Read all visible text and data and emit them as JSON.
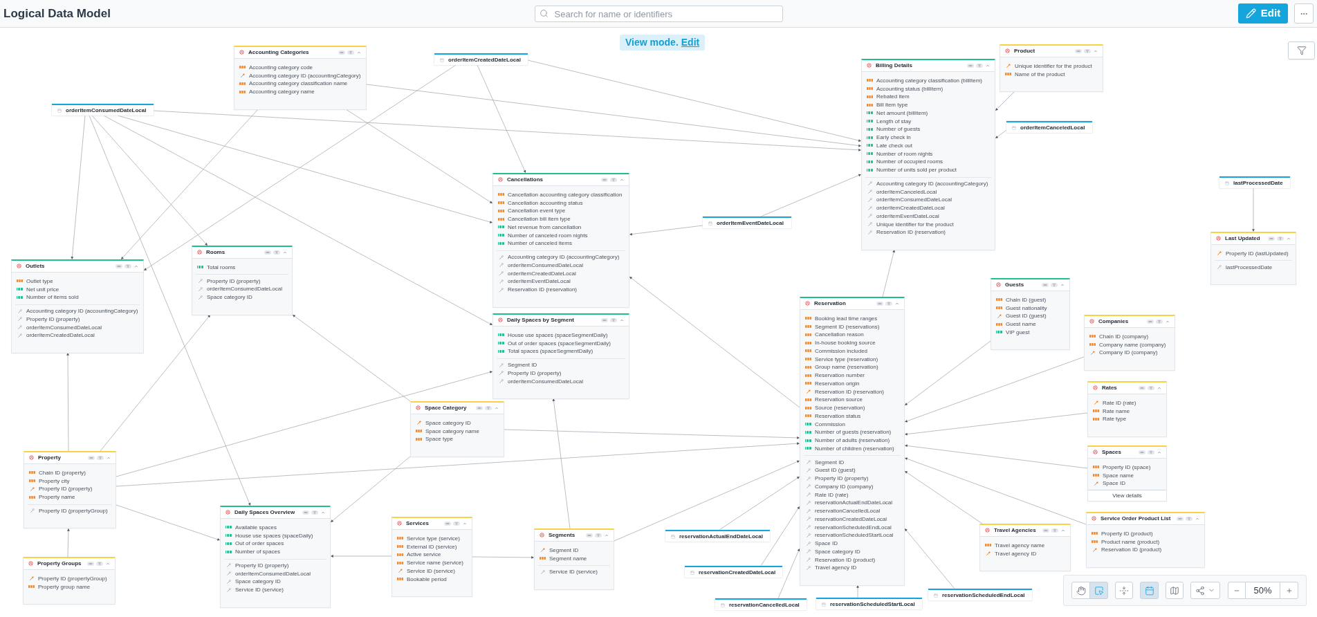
{
  "header": {
    "title": "Logical Data Model",
    "search": {
      "placeholder": "Search for name or identifiers"
    },
    "edit_button": "Edit"
  },
  "banner": {
    "text": "View mode.",
    "link": "Edit"
  },
  "datasets": [
    {
      "title": "Accounting Categories",
      "color": "#f7d344",
      "fields": [
        {
          "label": "Accounting category code",
          "kind": "attribute"
        },
        {
          "label": "Accounting category ID (accountingCategory)",
          "kind": "key"
        },
        {
          "label": "Accounting category classification name",
          "kind": "attribute"
        },
        {
          "label": "Accounting category name",
          "kind": "attribute"
        }
      ]
    },
    {
      "title": "Product",
      "color": "#f7d344",
      "fields": [
        {
          "label": "Unique identifier for the product",
          "kind": "key"
        },
        {
          "label": "Name of the product",
          "kind": "attribute"
        }
      ]
    },
    {
      "title": "Billing Details",
      "color": "#1dbf8e",
      "fields": [
        {
          "label": "Accounting category classification (billItem)",
          "kind": "attribute"
        },
        {
          "label": "Accounting status (billItem)",
          "kind": "attribute"
        },
        {
          "label": "Rebated item",
          "kind": "attribute"
        },
        {
          "label": "Bill item type",
          "kind": "attribute"
        },
        {
          "label": "Net amount (billItem)",
          "kind": "fact"
        },
        {
          "label": "Length of stay",
          "kind": "fact"
        },
        {
          "label": "Number of guests",
          "kind": "fact"
        },
        {
          "label": "Early check in",
          "kind": "fact"
        },
        {
          "label": "Late check out",
          "kind": "fact"
        },
        {
          "label": "Number of room nights",
          "kind": "fact"
        },
        {
          "label": "Number of occupied rooms",
          "kind": "fact"
        },
        {
          "label": "Number of units sold per product",
          "kind": "fact"
        }
      ],
      "references": [
        "Accounting category ID (accountingCategory)",
        "orderItemCanceledLocal",
        "orderItemConsumedDateLocal",
        "orderItemCreatedDateLocal",
        "orderItemEventDateLocal",
        "Unique identifier for the product",
        "Reservation ID (reservation)"
      ]
    },
    {
      "title": "Cancellations",
      "color": "#1dbf8e",
      "fields": [
        {
          "label": "Cancellation accounting category classification",
          "kind": "attribute"
        },
        {
          "label": "Cancellation accounting status",
          "kind": "attribute"
        },
        {
          "label": "Cancellation event type",
          "kind": "attribute"
        },
        {
          "label": "Cancellation bill item type",
          "kind": "attribute"
        },
        {
          "label": "Net revenue from cancellation",
          "kind": "fact"
        },
        {
          "label": "Number of canceled room nights",
          "kind": "fact"
        },
        {
          "label": "Number of canceled items",
          "kind": "fact"
        }
      ],
      "references": [
        "Accounting category ID (accountingCategory)",
        "orderItemConsumedDateLocal",
        "orderItemCreatedDateLocal",
        "orderItemEventDateLocal",
        "Reservation ID (reservation)"
      ]
    },
    {
      "title": "Last Updated",
      "color": "#f7d344",
      "fields": [
        {
          "label": "Property ID (lastUpdated)",
          "kind": "key"
        }
      ],
      "references": [
        "lastProcessedDate"
      ]
    },
    {
      "title": "Outlets",
      "color": "#1dbf8e",
      "fields": [
        {
          "label": "Outlet type",
          "kind": "attribute"
        },
        {
          "label": "Net unit price",
          "kind": "fact"
        },
        {
          "label": "Number of items sold",
          "kind": "fact"
        }
      ],
      "references": [
        "Accounting category ID (accountingCategory)",
        "Property ID (property)",
        "orderItemConsumedDateLocal",
        "orderItemCreatedDateLocal"
      ]
    },
    {
      "title": "Rooms",
      "color": "#1dbf8e",
      "fields": [
        {
          "label": "Total rooms",
          "kind": "fact"
        }
      ],
      "references": [
        "Property ID (property)",
        "orderItemConsumedDateLocal",
        "Space category ID"
      ]
    },
    {
      "title": "Guests",
      "color": "#1dbf8e",
      "fields": [
        {
          "label": "Chain ID (guest)",
          "kind": "attribute"
        },
        {
          "label": "Guest nationality",
          "kind": "attribute"
        },
        {
          "label": "Guest ID (guest)",
          "kind": "key"
        },
        {
          "label": "Guest name",
          "kind": "attribute"
        },
        {
          "label": "VIP guest",
          "kind": "fact"
        }
      ]
    },
    {
      "title": "Reservation",
      "color": "#1dbf8e",
      "fields": [
        {
          "label": "Booking lead time ranges",
          "kind": "attribute"
        },
        {
          "label": "Segment ID (reservations)",
          "kind": "attribute"
        },
        {
          "label": "Cancellation reason",
          "kind": "attribute"
        },
        {
          "label": "In-house booking source",
          "kind": "attribute"
        },
        {
          "label": "Commission included",
          "kind": "attribute"
        },
        {
          "label": "Service type (reservation)",
          "kind": "attribute"
        },
        {
          "label": "Group name (reservation)",
          "kind": "attribute"
        },
        {
          "label": "Reservation number",
          "kind": "attribute"
        },
        {
          "label": "Reservation origin",
          "kind": "attribute"
        },
        {
          "label": "Reservation ID (reservation)",
          "kind": "key"
        },
        {
          "label": "Reservation source",
          "kind": "attribute"
        },
        {
          "label": "Source (reservation)",
          "kind": "attribute"
        },
        {
          "label": "Reservation status",
          "kind": "attribute"
        },
        {
          "label": "Commission",
          "kind": "fact"
        },
        {
          "label": "Number of guests (reservation)",
          "kind": "fact"
        },
        {
          "label": "Number of adults (reservation)",
          "kind": "fact"
        },
        {
          "label": "Number of children (reservation)",
          "kind": "fact"
        }
      ],
      "references": [
        "Segment ID",
        "Guest ID (guest)",
        "Property ID (property)",
        "Company ID (company)",
        "Rate ID (rate)",
        "reservationActualEndDateLocal",
        "reservationCancelledLocal",
        "reservationCreatedDateLocal",
        "reservationScheduledEndLocal",
        "reservationScheduledStartLocal",
        "Space ID",
        "Space category ID",
        "Reservation ID (product)",
        "Travel agency ID"
      ]
    },
    {
      "title": "Daily Spaces by Segment",
      "color": "#1dbf8e",
      "fields": [
        {
          "label": "House use spaces (spaceSegmentDaily)",
          "kind": "fact"
        },
        {
          "label": "Out of order spaces (spaceSegmentDaily)",
          "kind": "fact"
        },
        {
          "label": "Total spaces (spaceSegmentDaily)",
          "kind": "fact"
        }
      ],
      "references": [
        "Segment ID",
        "Property ID (property)",
        "orderItemConsumedDateLocal"
      ]
    },
    {
      "title": "Companies",
      "color": "#f7d344",
      "fields": [
        {
          "label": "Chain ID (company)",
          "kind": "attribute"
        },
        {
          "label": "Company name (company)",
          "kind": "attribute"
        },
        {
          "label": "Company ID (company)",
          "kind": "key"
        }
      ]
    },
    {
      "title": "Rates",
      "color": "#f7d344",
      "fields": [
        {
          "label": "Rate ID (rate)",
          "kind": "key"
        },
        {
          "label": "Rate name",
          "kind": "attribute"
        },
        {
          "label": "Rate type",
          "kind": "attribute"
        }
      ]
    },
    {
      "title": "Space Category",
      "color": "#f7d344",
      "fields": [
        {
          "label": "Space category ID",
          "kind": "key"
        },
        {
          "label": "Space category name",
          "kind": "attribute"
        },
        {
          "label": "Space type",
          "kind": "attribute"
        }
      ]
    },
    {
      "title": "Spaces",
      "color": "#f7d344",
      "fields": [
        {
          "label": "Property ID (space)",
          "kind": "attribute"
        },
        {
          "label": "Space name",
          "kind": "attribute"
        },
        {
          "label": "Space ID",
          "kind": "key"
        }
      ],
      "button": "View details"
    },
    {
      "title": "Property",
      "color": "#f7d344",
      "fields": [
        {
          "label": "Chain ID (property)",
          "kind": "attribute"
        },
        {
          "label": "Property city",
          "kind": "attribute"
        },
        {
          "label": "Property ID (property)",
          "kind": "key"
        },
        {
          "label": "Property name",
          "kind": "attribute"
        }
      ],
      "references": [
        "Property ID (propertyGroup)"
      ]
    },
    {
      "title": "Daily Spaces Overview",
      "color": "#1dbf8e",
      "fields": [
        {
          "label": "Available spaces",
          "kind": "fact"
        },
        {
          "label": "House use spaces (spaceDaily)",
          "kind": "fact"
        },
        {
          "label": "Out of order spaces",
          "kind": "fact"
        },
        {
          "label": "Number of spaces",
          "kind": "fact"
        }
      ],
      "references": [
        "Property ID (property)",
        "orderItemConsumedDateLocal",
        "Space category ID",
        "Service ID (service)"
      ]
    },
    {
      "title": "Services",
      "color": "#f7d344",
      "fields": [
        {
          "label": "Service type (service)",
          "kind": "attribute"
        },
        {
          "label": "External ID (service)",
          "kind": "attribute"
        },
        {
          "label": "Active service",
          "kind": "attribute"
        },
        {
          "label": "Service name (service)",
          "kind": "attribute"
        },
        {
          "label": "Service ID (service)",
          "kind": "key"
        },
        {
          "label": "Bookable period",
          "kind": "attribute"
        }
      ]
    },
    {
      "title": "Segments",
      "color": "#f7d344",
      "fields": [
        {
          "label": "Segment ID",
          "kind": "key"
        },
        {
          "label": "Segment name",
          "kind": "attribute"
        }
      ],
      "references": [
        "Service ID (service)"
      ]
    },
    {
      "title": "Travel Agencies",
      "color": "#f7d344",
      "fields": [
        {
          "label": "Travel agency name",
          "kind": "attribute"
        },
        {
          "label": "Travel agency ID",
          "kind": "key"
        }
      ]
    },
    {
      "title": "Service Order Product List",
      "color": "#f7d344",
      "fields": [
        {
          "label": "Property ID (product)",
          "kind": "attribute"
        },
        {
          "label": "Product name (product)",
          "kind": "attribute"
        },
        {
          "label": "Reservation ID (product)",
          "kind": "key"
        }
      ]
    },
    {
      "title": "Property Groups",
      "color": "#f7d344",
      "fields": [
        {
          "label": "Property ID (propertyGroup)",
          "kind": "key"
        },
        {
          "label": "Property group name",
          "kind": "attribute"
        }
      ]
    }
  ],
  "date_datasets": [
    "orderItemCreatedDateLocal",
    "orderItemConsumedDateLocal",
    "orderItemCanceledLocal",
    "lastProcessedDate",
    "orderItemEventDateLocal",
    "reservationActualEndDateLocal",
    "reservationCreatedDateLocal",
    "reservationCancelledLocal",
    "reservationScheduledStartLocal",
    "reservationScheduledEndLocal"
  ],
  "toolbar": {
    "tools": [
      {
        "kind": "hand",
        "selected": false
      },
      {
        "kind": "select",
        "selected": true
      }
    ],
    "buttons": [
      {
        "kind": "layout",
        "selected": false
      },
      {
        "kind": "dates",
        "selected": true
      },
      {
        "kind": "map",
        "selected": false
      },
      {
        "kind": "share",
        "selected": false
      }
    ],
    "zoom": "50%"
  }
}
